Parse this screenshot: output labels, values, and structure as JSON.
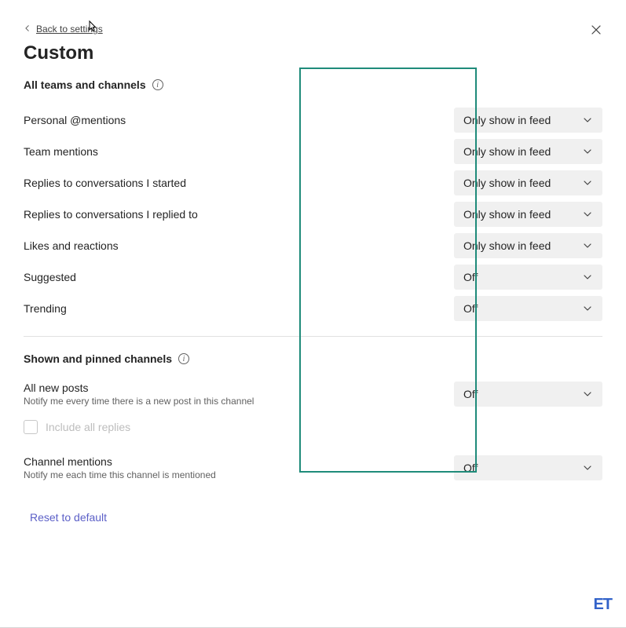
{
  "back_link": "Back to settings",
  "title": "Custom",
  "section1": {
    "header": "All teams and channels",
    "rows": [
      {
        "label": "Personal @mentions",
        "value": "Only show in feed"
      },
      {
        "label": "Team mentions",
        "value": "Only show in feed"
      },
      {
        "label": "Replies to conversations I started",
        "value": "Only show in feed"
      },
      {
        "label": "Replies to conversations I replied to",
        "value": "Only show in feed"
      },
      {
        "label": "Likes and reactions",
        "value": "Only show in feed"
      },
      {
        "label": "Suggested",
        "value": "Off"
      },
      {
        "label": "Trending",
        "value": "Off"
      }
    ]
  },
  "section2": {
    "header": "Shown and pinned channels",
    "all_new_posts": {
      "label": "All new posts",
      "sublabel": "Notify me every time there is a new post in this channel",
      "value": "Off"
    },
    "include_all_replies": "Include all replies",
    "channel_mentions": {
      "label": "Channel mentions",
      "sublabel": "Notify me each time this channel is mentioned",
      "value": "Off"
    }
  },
  "reset_link": "Reset to default",
  "logo": "ET"
}
